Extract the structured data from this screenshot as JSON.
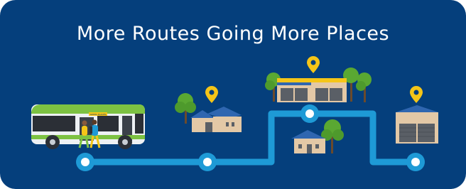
{
  "title": "More Routes Going More Places",
  "bus_sign": "GOING PLACES",
  "colors": {
    "background": "#053f7c",
    "route": "#1e9ad6",
    "pin": "#f5c518",
    "bus_green": "#7dc242",
    "tree": "#5aa832"
  },
  "icons": [
    "bus-icon",
    "pedestrian-icon",
    "house-icon",
    "shopping-center-icon",
    "warehouse-icon",
    "tree-icon",
    "location-pin-icon"
  ]
}
